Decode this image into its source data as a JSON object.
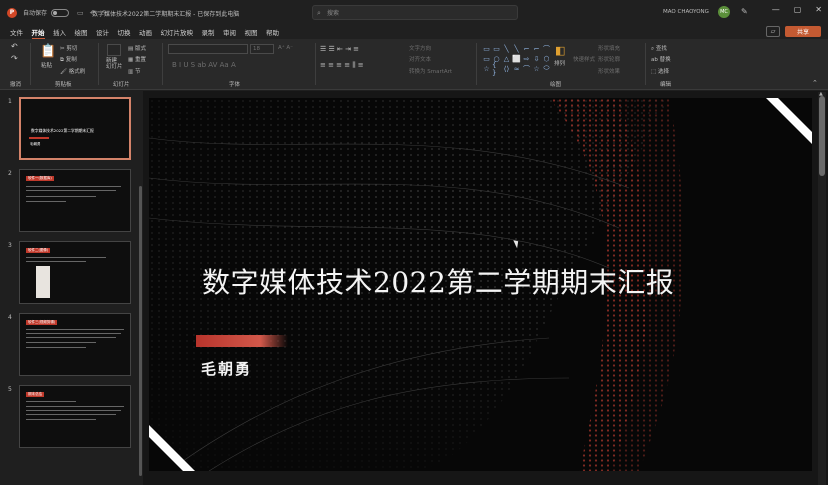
{
  "titlebar": {
    "autosave": "自动保存",
    "doc_title": "数字媒体技术2022第二学期期末汇报 - 已保存到此电脑",
    "search_placeholder": "搜索",
    "user_name": "MAO CHAOYONG",
    "avatar_initials": "MC"
  },
  "tabs": [
    "文件",
    "开始",
    "插入",
    "绘图",
    "设计",
    "切换",
    "动画",
    "幻灯片放映",
    "录制",
    "审阅",
    "视图",
    "帮助"
  ],
  "active_tab": "开始",
  "share_label": "共享",
  "ribbon": {
    "undo_label": "撤消",
    "clipboard": {
      "paste": "粘贴",
      "cut": "剪切",
      "copy": "复制",
      "format_painter": "格式刷",
      "label": "剪贴板"
    },
    "slides": {
      "new_slide": "新建\n幻灯片",
      "layout": "版式",
      "reset": "重置",
      "section": "节",
      "label": "幻灯片"
    },
    "font": {
      "label": "字体",
      "font_name": "",
      "font_size": "18"
    },
    "paragraph": {
      "convert_smartart": "转换为 SmartArt",
      "text_direction": "文字方向",
      "align_text": "对齐文本"
    },
    "drawing": {
      "arrange": "排列",
      "quick_styles": "快速样式",
      "shape_fill": "形状填充",
      "shape_outline": "形状轮廓",
      "shape_effects": "形状效果",
      "label": "绘图"
    },
    "editing": {
      "find": "查找",
      "replace": "替换",
      "select": "选择",
      "label": "编辑"
    }
  },
  "thumbnails": [
    {
      "num": "1",
      "title": "数字媒体技术2022第二学期期末汇报",
      "author": "毛朝勇",
      "selected": true
    },
    {
      "num": "2",
      "title": "软件一(数据库)"
    },
    {
      "num": "3",
      "title": "软件二(图像)"
    },
    {
      "num": "4",
      "title": "软件三(视频剪辑)"
    },
    {
      "num": "5",
      "title": "期末总结"
    }
  ],
  "slide": {
    "title": "数字媒体技术2022第二学期期末汇报",
    "author": "毛朝勇"
  },
  "colors": {
    "accent": "#c45a32",
    "slide_bar": "#c0392b",
    "background": "#070707"
  },
  "icons": [
    "powerpoint-logo",
    "save-icon",
    "undo-icon",
    "redo-icon",
    "search-icon",
    "pen-icon",
    "minimize-icon",
    "maximize-icon",
    "close-icon",
    "comment-icon"
  ]
}
